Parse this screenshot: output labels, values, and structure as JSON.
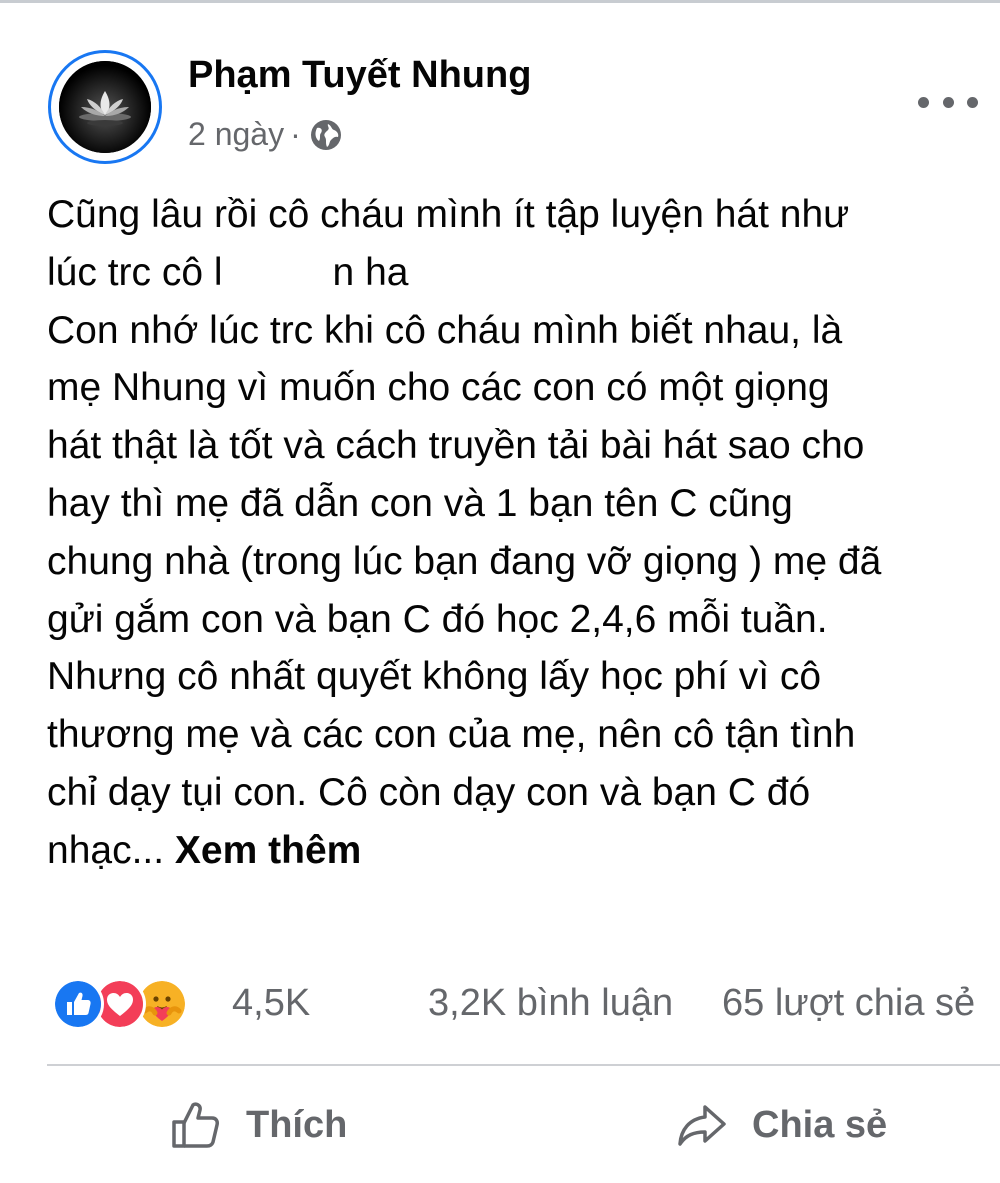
{
  "post": {
    "author": "Phạm Tuyết Nhung",
    "time": "2 ngày",
    "separator": "·",
    "audience_icon": "globe-icon",
    "more_icon": "more-options-icon",
    "text_lines": [
      "Cũng lâu rồi cô cháu mình ít tập luyện hát như",
      "lúc trc cô l",
      "n ha",
      "Con nhớ lúc trc khi cô cháu mình biết nhau, là",
      "mẹ Nhung vì muốn cho các con có một giọng",
      "hát thật là tốt và cách truyền tải bài hát sao cho",
      "hay thì mẹ đã dẫn con và 1 bạn tên C cũng",
      "chung nhà (trong lúc bạn đang vỡ giọng ) mẹ đã",
      "gửi gắm con và bạn C đó học 2,4,6 mỗi tuần.",
      "Nhưng cô nhất quyết không lấy học phí vì cô",
      "thương mẹ và các con của mẹ, nên cô tận tình",
      "chỉ dạy tụi con. Cô còn dạy con và bạn C đó",
      "nhạc..."
    ],
    "see_more": "Xem thêm"
  },
  "stats": {
    "reactions": [
      "like",
      "love",
      "care"
    ],
    "reaction_count": "4,5K",
    "comments": "3,2K bình luận",
    "shares": "65 lượt chia sẻ"
  },
  "actions": {
    "like_label": "Thích",
    "share_label": "Chia sẻ"
  },
  "colors": {
    "accent": "#1877f2",
    "secondary_text": "#65676b",
    "like_blue": "#1877f2",
    "love_red": "#f33e58",
    "care_yellow": "#f7b125"
  }
}
